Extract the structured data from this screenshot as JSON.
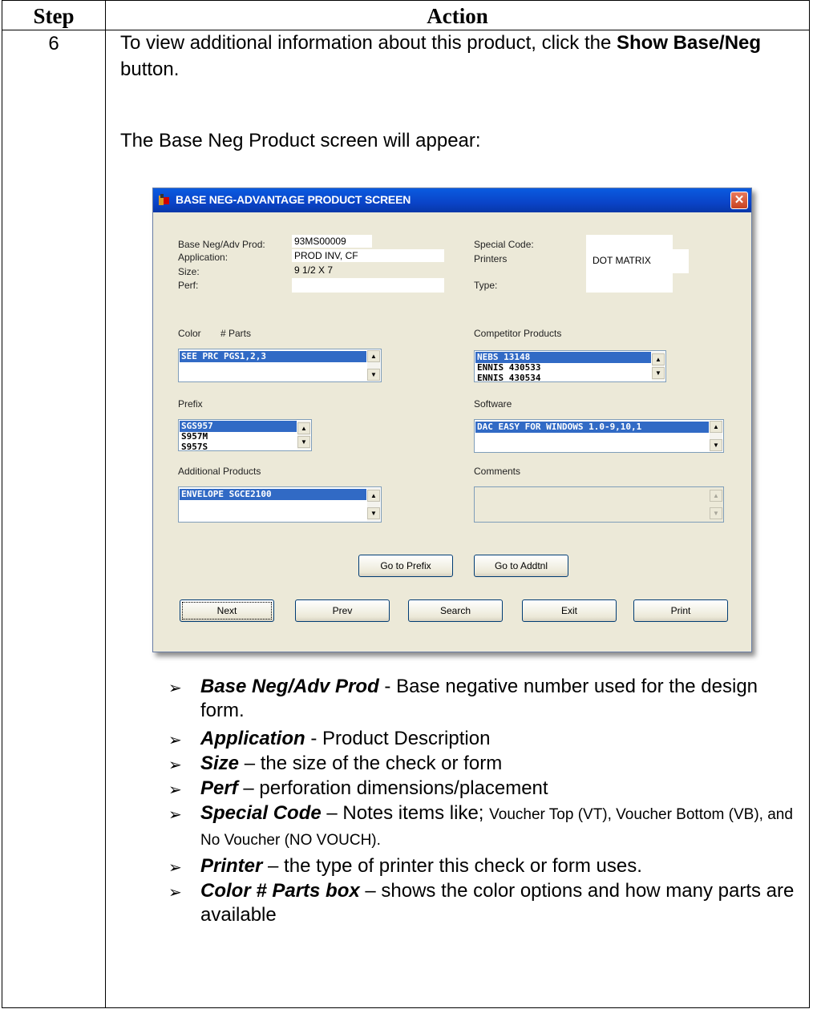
{
  "table": {
    "header_step": "Step",
    "header_action": "Action",
    "step_number": "6",
    "intro_part1": "To view additional information about this product, click the ",
    "intro_bold": "Show Base/Neg",
    "intro_part2": " button.",
    "screen_note": "The Base Neg Product screen will appear:"
  },
  "dialog": {
    "title": "BASE NEG-ADVANTAGE PRODUCT SCREEN",
    "close": "✕",
    "labels": {
      "base_neg": "Base Neg/Adv Prod:",
      "application": "Application:",
      "size": "Size:",
      "perf": "Perf:",
      "special_code": "Special Code:",
      "printers": "Printers",
      "type": "Type:",
      "color": "Color",
      "parts": "# Parts",
      "competitor": "Competitor Products",
      "prefix": "Prefix",
      "software": "Software",
      "additional": "Additional Products",
      "comments": "Comments"
    },
    "values": {
      "base_neg": "93MS00009",
      "application": "PROD INV, CF",
      "size": "9 1/2 X 7",
      "perf": "",
      "special_code": "",
      "printers": "DOT MATRIX",
      "type": ""
    },
    "color_list": [
      "SEE PRC PGS1,2,3"
    ],
    "competitor_list": [
      "NEBS          13148",
      "ENNIS        430533",
      "ENNIS        430534"
    ],
    "prefix_list": [
      "SGS957",
      "S957M",
      "S957S"
    ],
    "software_list": [
      "DAC EASY FOR WINDOWS 1.0-9,10,1"
    ],
    "additional_list": [
      "ENVELOPE      SGCE2100"
    ],
    "buttons": {
      "go_prefix": "Go to Prefix",
      "go_addtnl": "Go to Addtnl",
      "next": "Next",
      "prev": "Prev",
      "search": "Search",
      "exit": "Exit",
      "print": "Print"
    }
  },
  "bullets": [
    {
      "term": "Base Neg/Adv Prod",
      "sep": " - ",
      "desc": "Base negative number used for the design form."
    },
    {
      "term": "Application",
      "sep": " - ",
      "desc": "Product Description"
    },
    {
      "term": "Size",
      "sep": " – ",
      "desc": "the size of the check or form"
    },
    {
      "term": "Perf",
      "sep": " – ",
      "desc": "perforation dimensions/placement"
    },
    {
      "term": "Special Code",
      "sep": " – ",
      "desc": "Notes items like; ",
      "small": "Voucher Top (VT), Voucher Bottom (VB), and No Voucher (NO VOUCH)."
    },
    {
      "term": "Printer",
      "sep": " – ",
      "desc": "the type of printer this check or form uses."
    },
    {
      "term": "Color # Parts box",
      "sep": " – ",
      "desc": "shows the color options and how many parts are available"
    }
  ],
  "bullet_marker": "➢"
}
